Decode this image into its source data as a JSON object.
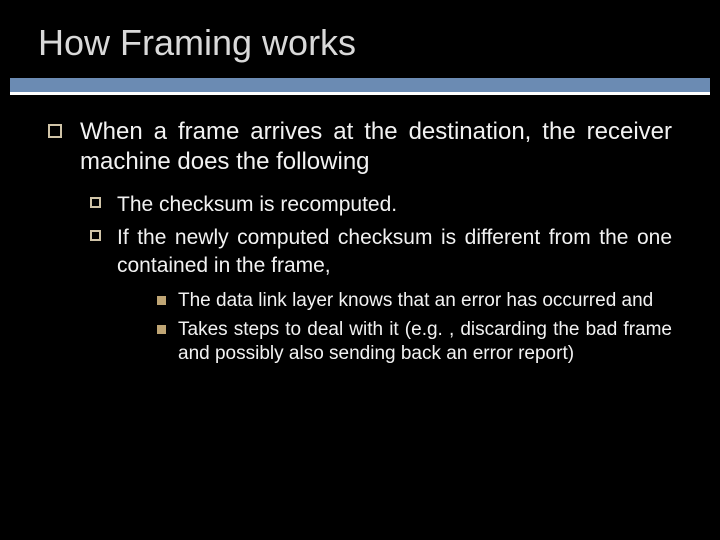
{
  "title": "How Framing works",
  "main": {
    "text": "When a frame arrives at the destination, the receiver machine does the following",
    "sub": [
      {
        "text": "The checksum is recomputed."
      },
      {
        "text": "If the newly computed checksum is different from the one contained in the frame,",
        "sub": [
          {
            "text": "The data link layer knows that an error has occurred and"
          },
          {
            "text": "Takes steps to deal with it (e.g. , discarding the bad frame and possibly also sending back an error report)"
          }
        ]
      }
    ]
  }
}
